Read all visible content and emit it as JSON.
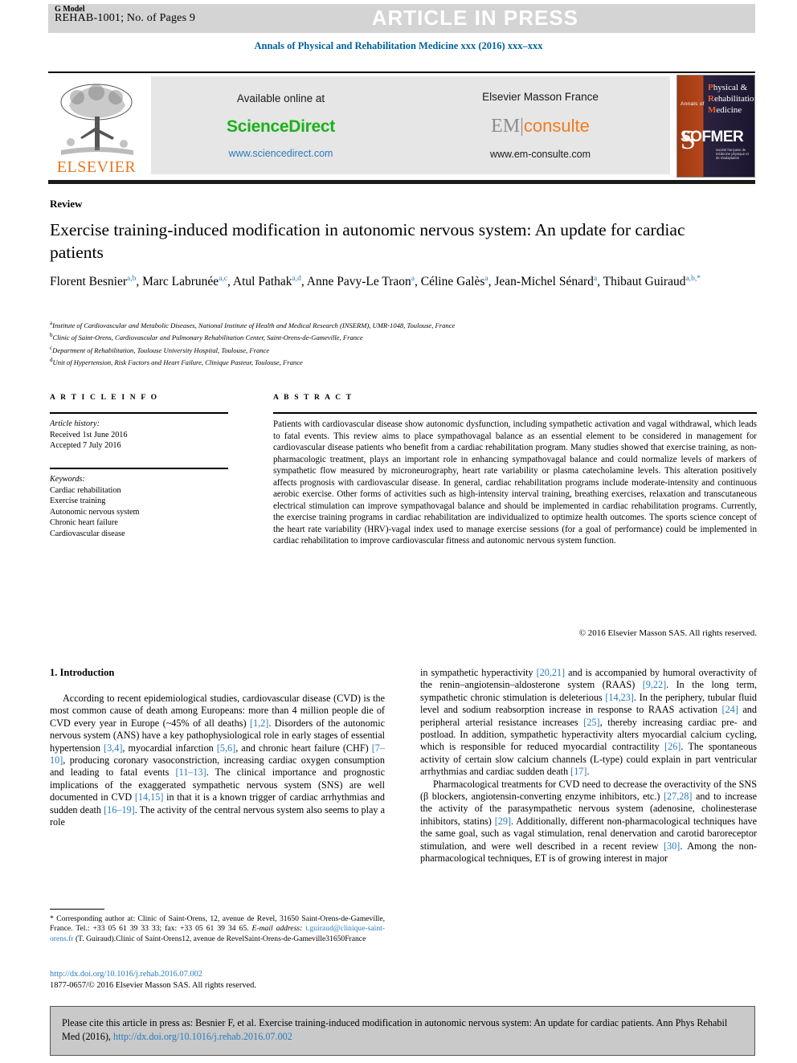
{
  "banner": {
    "g_model": "G Model",
    "article_id": "REHAB-1001; No. of Pages 9",
    "article_in_press": "ARTICLE IN PRESS"
  },
  "journal_line": "Annals of Physical and Rehabilitation Medicine xxx (2016) xxx–xxx",
  "masthead": {
    "elsevier_wordmark": "ELSEVIER",
    "available_online_at": "Available online at",
    "sciencedirect": "ScienceDirect",
    "sciencedirect_url": "www.sciencedirect.com",
    "elsevier_masson_france": "Elsevier Masson France",
    "em_prefix": "EM",
    "em_suffix": "consulte",
    "em_url": "www.em-consulte.com",
    "cover": {
      "annals_of": "Annals of",
      "line1": "Physical &",
      "line2": "Rehabilitation",
      "line3": "Medicine",
      "sofmer": "SOFMER",
      "sofmer_sub": "société française de médecine physique et de réadaptation"
    }
  },
  "article": {
    "section_type": "Review",
    "title": "Exercise training-induced modification in autonomic nervous system: An update for cardiac patients",
    "authors_html": "Florent Besnier<sup>a,b</sup>, Marc Labrunée<sup>a,c</sup>, Atul Pathak<sup>a,d</sup>, Anne Pavy-Le Traon<sup>a</sup>, Céline Galès<sup>a</sup>, Jean-Michel Sénard<sup>a</sup>, Thibaut Guiraud<sup>a,b,*</sup>",
    "affiliations": [
      {
        "marker": "a",
        "text": "Institute of Cardiovascular and Metabolic Diseases, National Institute of Health and Medical Research (INSERM), UMR-1048, Toulouse, France"
      },
      {
        "marker": "b",
        "text": "Clinic of Saint-Orens, Cardiovascular and Pulmonary Rehabilitation Center, Saint-Orens-de-Gameville, France"
      },
      {
        "marker": "c",
        "text": "Department of Rehabilitation, Toulouse University Hospital, Toulouse, France"
      },
      {
        "marker": "d",
        "text": "Unit of Hypertension, Risk Factors and Heart Failure, Clinique Pasteur, Toulouse, France"
      }
    ]
  },
  "article_info": {
    "heading": "A R T I C L E   I N F O",
    "history_label": "Article history:",
    "received": "Received 1st June 2016",
    "accepted": "Accepted 7 July 2016",
    "keywords_label": "Keywords:",
    "keywords": [
      "Cardiac rehabilitation",
      "Exercise training",
      "Autonomic nervous system",
      "Chronic heart failure",
      "Cardiovascular disease"
    ]
  },
  "abstract": {
    "heading": "A B S T R A C T",
    "text": "Patients with cardiovascular disease show autonomic dysfunction, including sympathetic activation and vagal withdrawal, which leads to fatal events. This review aims to place sympathovagal balance as an essential element to be considered in management for cardiovascular disease patients who benefit from a cardiac rehabilitation program. Many studies showed that exercise training, as non-pharmacologic treatment, plays an important role in enhancing sympathovagal balance and could normalize levels of markers of sympathetic flow measured by microneurography, heart rate variability or plasma catecholamine levels. This alteration positively affects prognosis with cardiovascular disease. In general, cardiac rehabilitation programs include moderate-intensity and continuous aerobic exercise. Other forms of activities such as high-intensity interval training, breathing exercises, relaxation and transcutaneous electrical stimulation can improve sympathovagal balance and should be implemented in cardiac rehabilitation programs. Currently, the exercise training programs in cardiac rehabilitation are individualized to optimize health outcomes. The sports science concept of the heart rate variability (HRV)-vagal index used to manage exercise sessions (for a goal of performance) could be implemented in cardiac rehabilitation to improve cardiovascular fitness and autonomic nervous system function.",
    "copyright": "© 2016 Elsevier Masson SAS. All rights reserved."
  },
  "body": {
    "section_heading": "1. Introduction",
    "left_paragraph_html": "According to recent epidemiological studies, cardiovascular disease (CVD) is the most common cause of death among Europeans: more than 4 million people die of CVD every year in Europe (~45% of all deaths) <span class=\"ref\">[1,2]</span>. Disorders of the autonomic nervous system (ANS) have a key pathophysiological role in early stages of essential hypertension <span class=\"ref\">[3,4]</span>, myocardial infarction <span class=\"ref\">[5,6]</span>, and chronic heart failure (CHF) <span class=\"ref\">[7–10]</span>, producing coronary vasoconstriction, increasing cardiac oxygen consumption and leading to fatal events <span class=\"ref\">[11–13]</span>. The clinical importance and prognostic implications of the exaggerated sympathetic nervous system (SNS) are well documented in CVD <span class=\"ref\">[14,15]</span> in that it is a known trigger of cardiac arrhythmias and sudden death <span class=\"ref\">[16–19]</span>. The activity of the central nervous system also seems to play a role",
    "right_paragraph_1_html": "in sympathetic hyperactivity <span class=\"ref\">[20,21]</span> and is accompanied by humoral overactivity of the renin–angiotensin–aldosterone system (RAAS) <span class=\"ref\">[9,22]</span>. In the long term, sympathetic chronic stimulation is deleterious <span class=\"ref\">[14,23]</span>. In the periphery, tubular fluid level and sodium reabsorption increase in response to RAAS activation <span class=\"ref\">[24]</span> and peripheral arterial resistance increases <span class=\"ref\">[25]</span>, thereby increasing cardiac pre- and postload. In addition, sympathetic hyperactivity alters myocardial calcium cycling, which is responsible for reduced myocardial contractility <span class=\"ref\">[26]</span>. The spontaneous activity of certain slow calcium channels (L-type) could explain in part ventricular arrhythmias and cardiac sudden death <span class=\"ref\">[17]</span>.",
    "right_paragraph_2_html": "Pharmacological treatments for CVD need to decrease the overactivity of the SNS (β blockers, angiotensin-converting enzyme inhibitors, etc.) <span class=\"ref\">[27,28]</span> and to increase the activity of the parasympathetic nervous system (adenosine, cholinesterase inhibitors, statins) <span class=\"ref\">[29]</span>. Additionally, different non-pharmacological techniques have the same goal, such as vagal stimulation, renal denervation and carotid baroreceptor stimulation, and were well described in a recent review <span class=\"ref\">[30]</span>. Among the non-pharmacological techniques, ET is of growing interest in major"
  },
  "footnote": {
    "corresponding_html": "* Corresponding author at: Clinic of Saint-Orens, 12, avenue de Revel, 31650 Saint-Orens-de-Gameville, France. Tel.: +33 05 61 39 33 33; fax: +33 05 61 39 34 65.",
    "email_label": "E-mail address:",
    "email": "t.guiraud@clinique-saint-orens.fr",
    "email_suffix": "(T. Guiraud).Clinic of Saint-Orens12, avenue de RevelSaint-Orens-de-Gameville31650France"
  },
  "doi_block": {
    "doi": "http://dx.doi.org/10.1016/j.rehab.2016.07.002",
    "issn_copyright": "1877-0657/© 2016 Elsevier Masson SAS. All rights reserved."
  },
  "cite_box": {
    "text_before": "Please cite this article in press as: Besnier F, et al. Exercise training-induced modification in autonomic nervous system: An update for cardiac patients. Ann Phys Rehabil Med (2016),",
    "doi": "http://dx.doi.org/10.1016/j.rehab.2016.07.002"
  },
  "colors": {
    "journal_blue": "#00619c",
    "link_blue": "#2b7bba",
    "elsevier_orange": "#e87722",
    "sciencedirect_green": "#1bb11b",
    "banner_grey": "#d4d4d4",
    "masthead_grey": "#e6e6e6",
    "citebox_grey": "#c9c9c9"
  }
}
